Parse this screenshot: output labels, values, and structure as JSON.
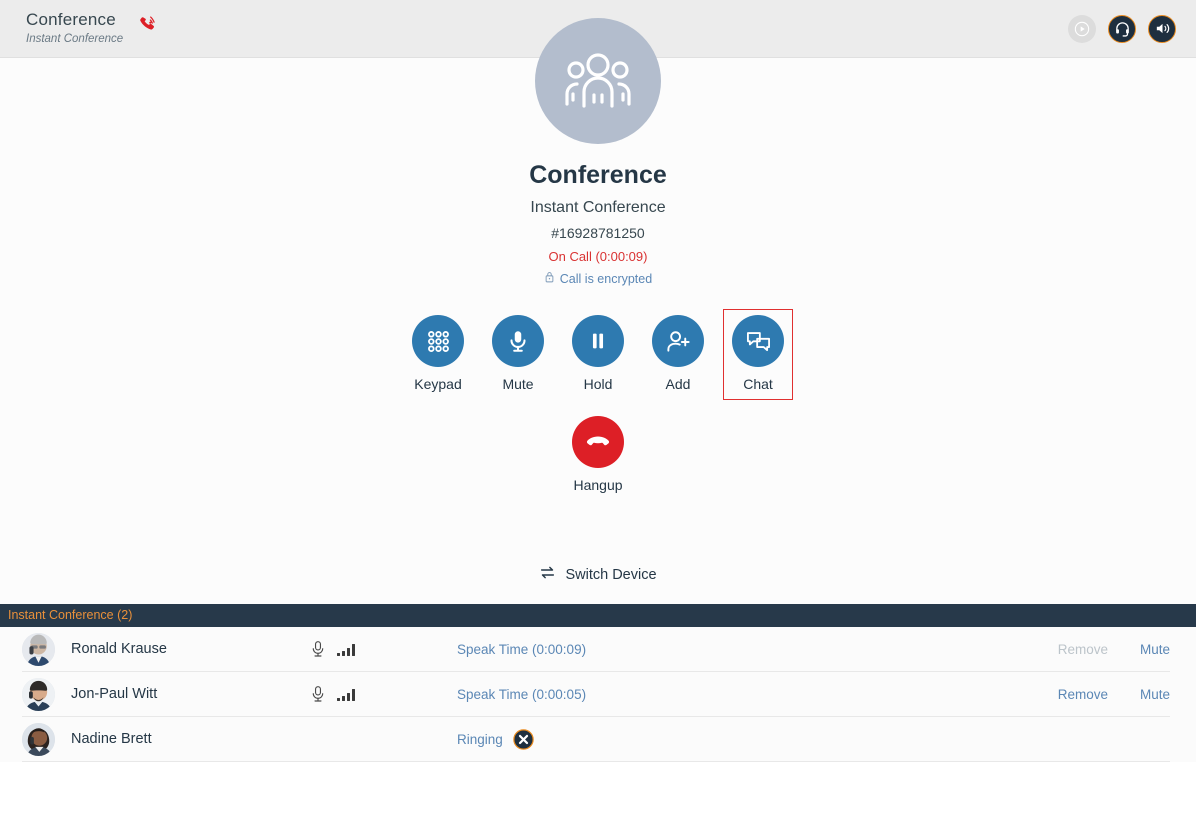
{
  "header": {
    "title": "Conference",
    "subtitle": "Instant Conference",
    "call_icon": "phone-active-icon",
    "right_icons": [
      {
        "name": "play-icon",
        "label": "Play",
        "disabled": true
      },
      {
        "name": "headset-icon",
        "label": "Headset",
        "disabled": false
      },
      {
        "name": "speaker-icon",
        "label": "Speaker",
        "disabled": false
      }
    ]
  },
  "call": {
    "avatar_icon": "group-people-icon",
    "name": "Conference",
    "subtitle": "Instant Conference",
    "id": "#16928781250",
    "status": "On Call (0:00:09)",
    "encrypted_label": "Call is encrypted",
    "encrypted_icon": "lock-icon"
  },
  "actions": [
    {
      "label": "Keypad",
      "icon": "keypad-icon",
      "highlighted": false
    },
    {
      "label": "Mute",
      "icon": "microphone-icon",
      "highlighted": false
    },
    {
      "label": "Hold",
      "icon": "pause-icon",
      "highlighted": false
    },
    {
      "label": "Add",
      "icon": "add-person-icon",
      "highlighted": false
    },
    {
      "label": "Chat",
      "icon": "chat-bubbles-icon",
      "highlighted": true
    }
  ],
  "hangup": {
    "label": "Hangup",
    "icon": "hangup-phone-icon"
  },
  "switch_device": {
    "label": "Switch Device",
    "icon": "switch-arrows-icon"
  },
  "participants_panel": {
    "title": "Instant Conference (2)",
    "rows": [
      {
        "name": "Ronald Krause",
        "mic_icon": "microphone-icon",
        "signal_icon": "signal-bars-icon",
        "status": "Speak Time (0:00:09)",
        "remove_label": "Remove",
        "remove_disabled": true,
        "mute_label": "Mute",
        "has_cancel_icon": false
      },
      {
        "name": "Jon-Paul Witt",
        "mic_icon": "microphone-icon",
        "signal_icon": "signal-bars-icon",
        "status": "Speak Time (0:00:05)",
        "remove_label": "Remove",
        "remove_disabled": false,
        "mute_label": "Mute",
        "has_cancel_icon": false
      },
      {
        "name": "Nadine Brett",
        "mic_icon": "",
        "signal_icon": "",
        "status": "Ringing",
        "remove_label": "",
        "remove_disabled": false,
        "mute_label": "",
        "has_cancel_icon": true,
        "cancel_icon": "cancel-x-icon"
      }
    ]
  },
  "colors": {
    "accent_blue": "#2e7ab0",
    "hangup_red": "#dd1f26",
    "highlight_red": "#e03030",
    "panel_dark": "#27394a",
    "panel_orange": "#e9903a",
    "link_blue": "#5b87b5",
    "status_red": "#d93333"
  }
}
